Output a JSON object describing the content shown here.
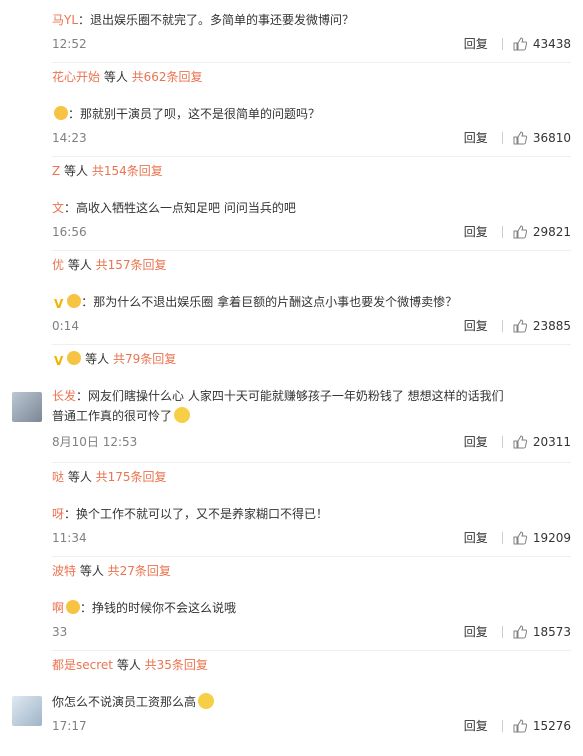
{
  "comments": [
    {
      "name": "马YL",
      "text": "：退出娱乐圈不就完了。多简单的事还要发微博问？",
      "time": "12:52",
      "reply": "回复",
      "likes": "43438",
      "reply_summary": {
        "user": "花心开始",
        "mid": " 等人 ",
        "count": "共662条回复"
      }
    },
    {
      "name": "",
      "text": "：那就别干演员了呗，这不是很简单的问题吗？",
      "time": "14:23",
      "reply": "回复",
      "likes": "36810",
      "reply_summary": {
        "user": "Z",
        "mid": " 等人 ",
        "count": "共154条回复"
      }
    },
    {
      "name": "文",
      "text": "：高收入牺牲这么一点知足吧  问问当兵的吧",
      "time": "16:56",
      "reply": "回复",
      "likes": "29821",
      "reply_summary": {
        "user": "优",
        "mid": " 等人 ",
        "count": "共157条回复"
      }
    },
    {
      "name": "",
      "text": "：那为什么不退出娱乐圈 拿着巨额的片酬这点小事也要发个微博卖惨？",
      "time": "0:14",
      "reply": "回复",
      "likes": "23885",
      "reply_summary": {
        "user": "",
        "mid": " 等人 ",
        "count": "共79条回复"
      }
    },
    {
      "name": "长发",
      "text": "：网友们瞎操什么心 人家四十天可能就赚够孩子一年奶粉钱了 想想这样的话我们",
      "text2": "普通工作真的很可怜了",
      "time": "8月10日 12:53",
      "reply": "回复",
      "likes": "20311",
      "reply_summary": {
        "user": "哒",
        "mid": " 等人 ",
        "count": "共175条回复"
      }
    },
    {
      "name": "呀",
      "text": "：换个工作不就可以了，又不是养家糊口不得已！",
      "time": "11:34",
      "reply": "回复",
      "likes": "19209",
      "reply_summary": {
        "user": "波特",
        "mid": " 等人 ",
        "count": "共27条回复"
      }
    },
    {
      "name": "啊",
      "text": "：挣钱的时候你不会这么说哦",
      "time": "33",
      "reply": "回复",
      "likes": "18573",
      "reply_summary": {
        "user": "都是secret",
        "mid": " 等人 ",
        "count": "共35条回复"
      }
    },
    {
      "name": "",
      "text": "你怎么不说演员工资那么高",
      "time": "17:17",
      "reply": "回复",
      "likes": "15276"
    }
  ]
}
